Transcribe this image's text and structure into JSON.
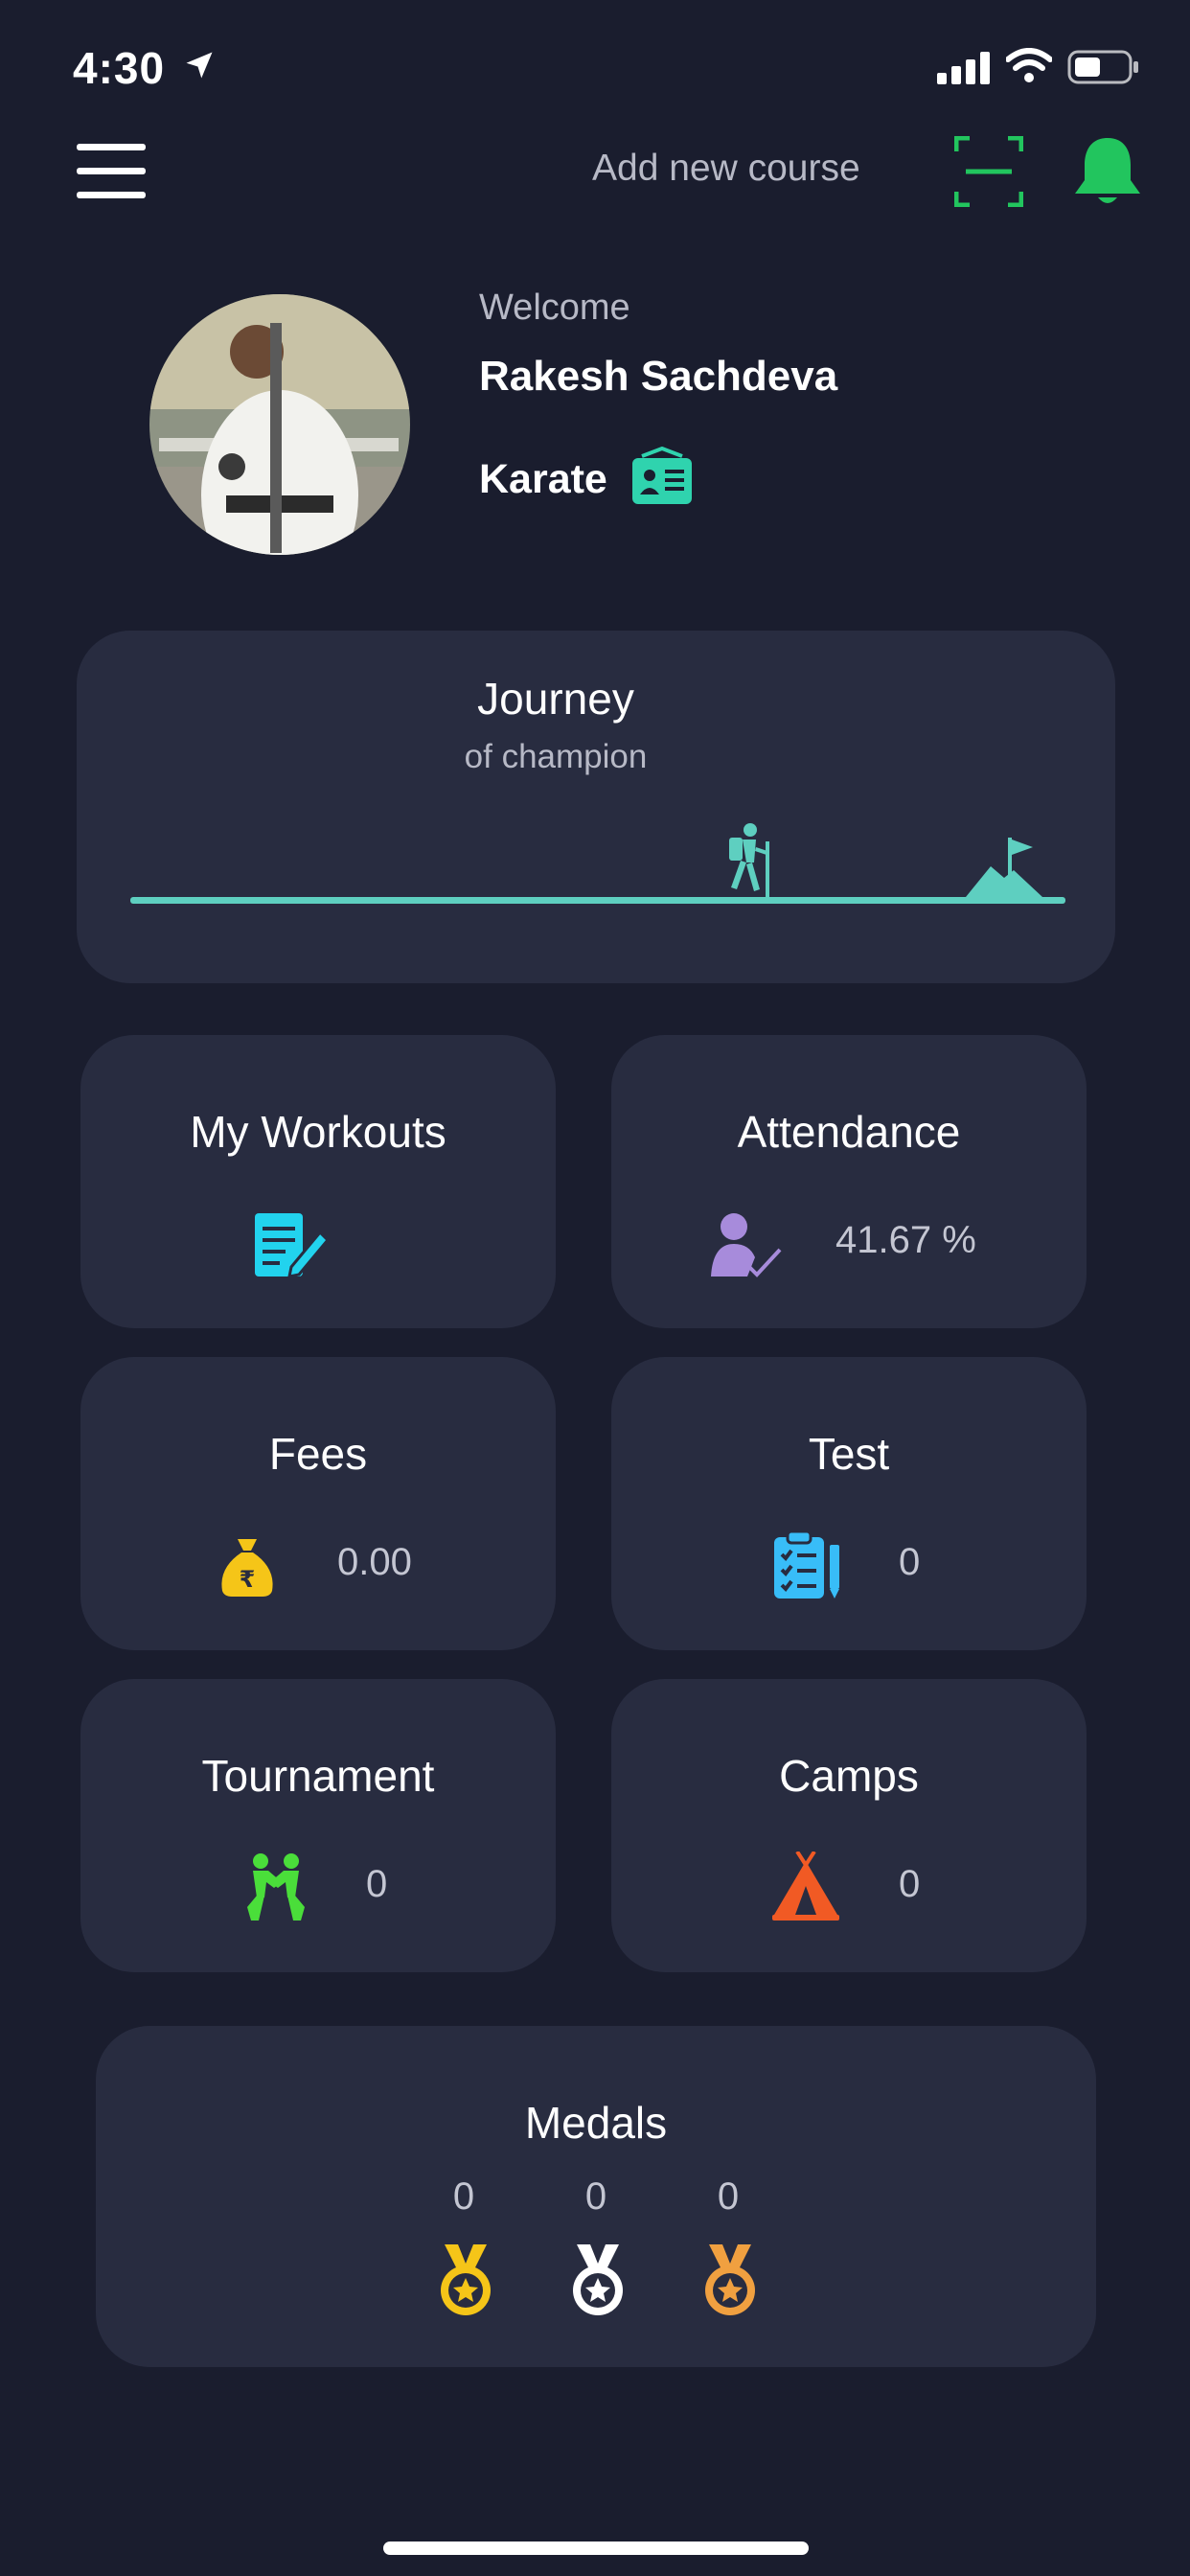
{
  "status_bar": {
    "time": "4:30"
  },
  "header": {
    "add_course_label": "Add new course"
  },
  "profile": {
    "welcome": "Welcome",
    "name": "Rakesh Sachdeva",
    "course": "Karate"
  },
  "journey": {
    "title": "Journey",
    "subtitle": "of champion",
    "progress": 0.66
  },
  "cards": {
    "workouts": {
      "title": "My Workouts"
    },
    "attendance": {
      "title": "Attendance",
      "value": "41.67 %"
    },
    "fees": {
      "title": "Fees",
      "value": "0.00"
    },
    "test": {
      "title": "Test",
      "value": "0"
    },
    "tournament": {
      "title": "Tournament",
      "value": "0"
    },
    "camps": {
      "title": "Camps",
      "value": "0"
    }
  },
  "medals": {
    "title": "Medals",
    "gold": "0",
    "silver": "0",
    "bronze": "0"
  },
  "colors": {
    "background": "#1a1d2e",
    "card": "#282c40",
    "accent_green": "#22c55e",
    "teal": "#5ecfc0",
    "cyan": "#22d3ee",
    "purple": "#a78bdb",
    "gold": "#f5c518",
    "orange": "#f15a24"
  },
  "icons": [
    "menu-icon",
    "scan-icon",
    "bell-icon",
    "id-card-icon",
    "hiker-icon",
    "summit-flag-icon",
    "document-edit-icon",
    "user-check-icon",
    "money-bag-icon",
    "clipboard-list-icon",
    "wrestlers-icon",
    "tent-icon",
    "gold-medal-icon",
    "silver-medal-icon",
    "bronze-medal-icon"
  ]
}
